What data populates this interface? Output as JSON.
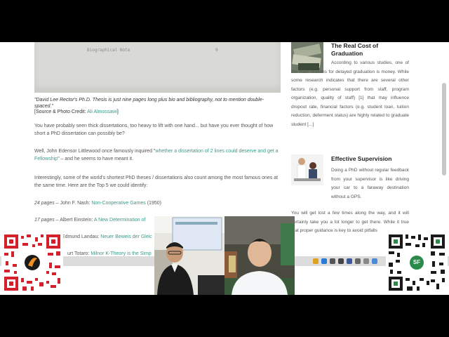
{
  "article": {
    "scan_rows": [
      {
        "label": "Biographical Note",
        "page": "9"
      }
    ],
    "caption": "\"David Lee Rector's Ph.D. Thesis is just nine pages long plus bio and bibliography, not to mention double-spaced.\"",
    "source_prefix": "[Source & Photo Credit: ",
    "source_link": "Ali Almossawi",
    "source_suffix": "]",
    "para1": "You have probably seen thick dissertations, too heavy to lift with one hand... but have you ever thought of how short a PhD dissertation can possibly be?",
    "para2_prefix": "Well, John Edensor Littlewood once famously inquired \"",
    "para2_link": "whether a dissertation of 2 lines could deserve and get a Fellowship",
    "para2_suffix": "\" – and he seems to have meant it.",
    "para3": "Interestingly, some of the world's shortest PhD theses / dissertations also count among the most famous ones at the same time. Here are the Top 5 we could identify:",
    "list": [
      {
        "pages": "24 pages",
        "author": " – John F. Nash: ",
        "title": "Non-Cooperative Games",
        "year": " (1950)"
      },
      {
        "pages": "17 pages",
        "author": " – Albert Einstein: ",
        "title": "A New Determination of",
        "year": ""
      },
      {
        "pages": "",
        "author": "Edmund Landau: ",
        "title": "Neuer Beweis der Gleic",
        "year": ""
      },
      {
        "pages": "",
        "author": "urt Totaro: ",
        "title": "Milnor K-Theory is the Simp",
        "year": ""
      }
    ]
  },
  "sidebar": {
    "item1": {
      "title_line1": "The Real Cost of",
      "title_line2": "Graduation",
      "text": "According to various studies, one of the main reasons for delayed graduation is money. While some research indicates that there are several other factors (e.g. personal support from staff, program organization, quality of staff) [1] that may influence dropout rate, financial factors (e.g. student loan, tuition reduction, deferment status) are highly related to graduate student [...]"
    },
    "item2": {
      "title": "Effective Supervision",
      "text_narrow": "Doing a PhD without regular feedback from your supervisor is like driving your car to a faraway destination without a GPS.",
      "text_wide": "You will get lost a few times along the way, and it will certainly take you a lot longer to get there. While it true that proper guidance is key to avoid pitfalls"
    }
  },
  "overlay": {
    "qr_right_badge": "SF"
  },
  "colors": {
    "link": "#3a9a8a",
    "qr_left": "#d4202a",
    "qr_right": "#2a8a4a"
  }
}
